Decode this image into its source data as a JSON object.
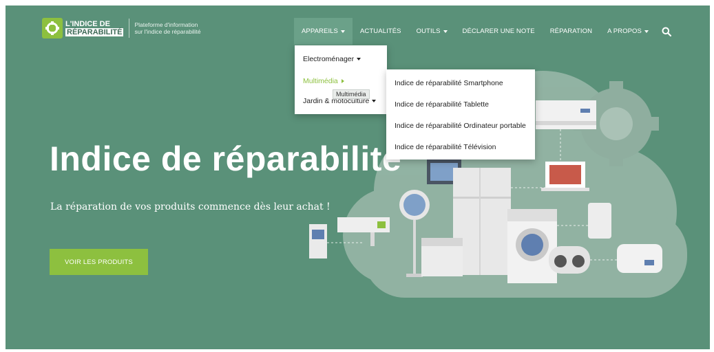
{
  "logo": {
    "line1": "L'INDICE DE",
    "line2": "RÉPARABILITÉ",
    "tagline1": "Plateforme d'information",
    "tagline2": "sur l'indice de réparabilité"
  },
  "nav": {
    "items": [
      {
        "label": "APPAREILS",
        "has_caret": true
      },
      {
        "label": "ACTUALITÉS"
      },
      {
        "label": "OUTILS",
        "has_caret": true
      },
      {
        "label": "DÉCLARER UNE NOTE"
      },
      {
        "label": "RÉPARATION"
      },
      {
        "label": "A PROPOS",
        "has_caret": true
      }
    ],
    "search_icon": "search-icon"
  },
  "dropdown": {
    "items": [
      "Electroménager",
      "Multimédia",
      "Jardin & motoculture"
    ],
    "tooltip": "Multimédia"
  },
  "submenu": {
    "items": [
      "Indice de réparabilité Smartphone",
      "Indice de réparabilité Tablette",
      "Indice de réparabilité Ordinateur portable",
      "Indice de réparabilité Télévision"
    ]
  },
  "hero": {
    "title": "Indice de réparabilite",
    "subtitle": "La réparation de vos produits commence dès leur achat !",
    "cta": "VOIR LES PRODUITS"
  },
  "colors": {
    "background": "#5a9179",
    "accent": "#8dc03f",
    "nav_active": "#6ba189"
  }
}
